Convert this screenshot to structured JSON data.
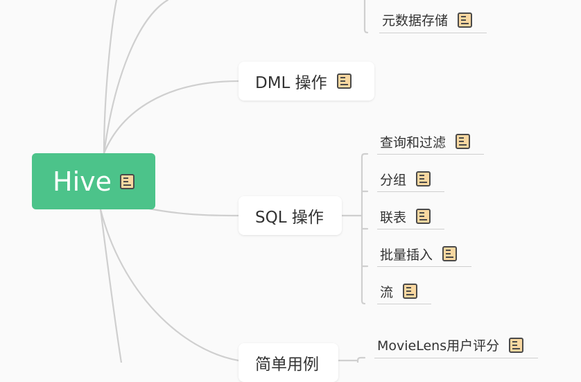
{
  "root": {
    "label": "Hive"
  },
  "branches": {
    "metadata": {
      "label": "元数据存储"
    },
    "dml": {
      "label": "DML 操作"
    },
    "sql": {
      "label": "SQL 操作",
      "children": [
        "查询和过滤",
        "分组",
        "联表",
        "批量插入",
        "流"
      ]
    },
    "examples": {
      "label": "简单用例",
      "children": [
        "MovieLens用户评分"
      ]
    }
  },
  "icons": {
    "note": "note-icon"
  },
  "colors": {
    "root_fill": "#4cc38a",
    "note_fill": "#f8d7a0",
    "line": "#cfcfcf",
    "background": "#fafafa"
  }
}
